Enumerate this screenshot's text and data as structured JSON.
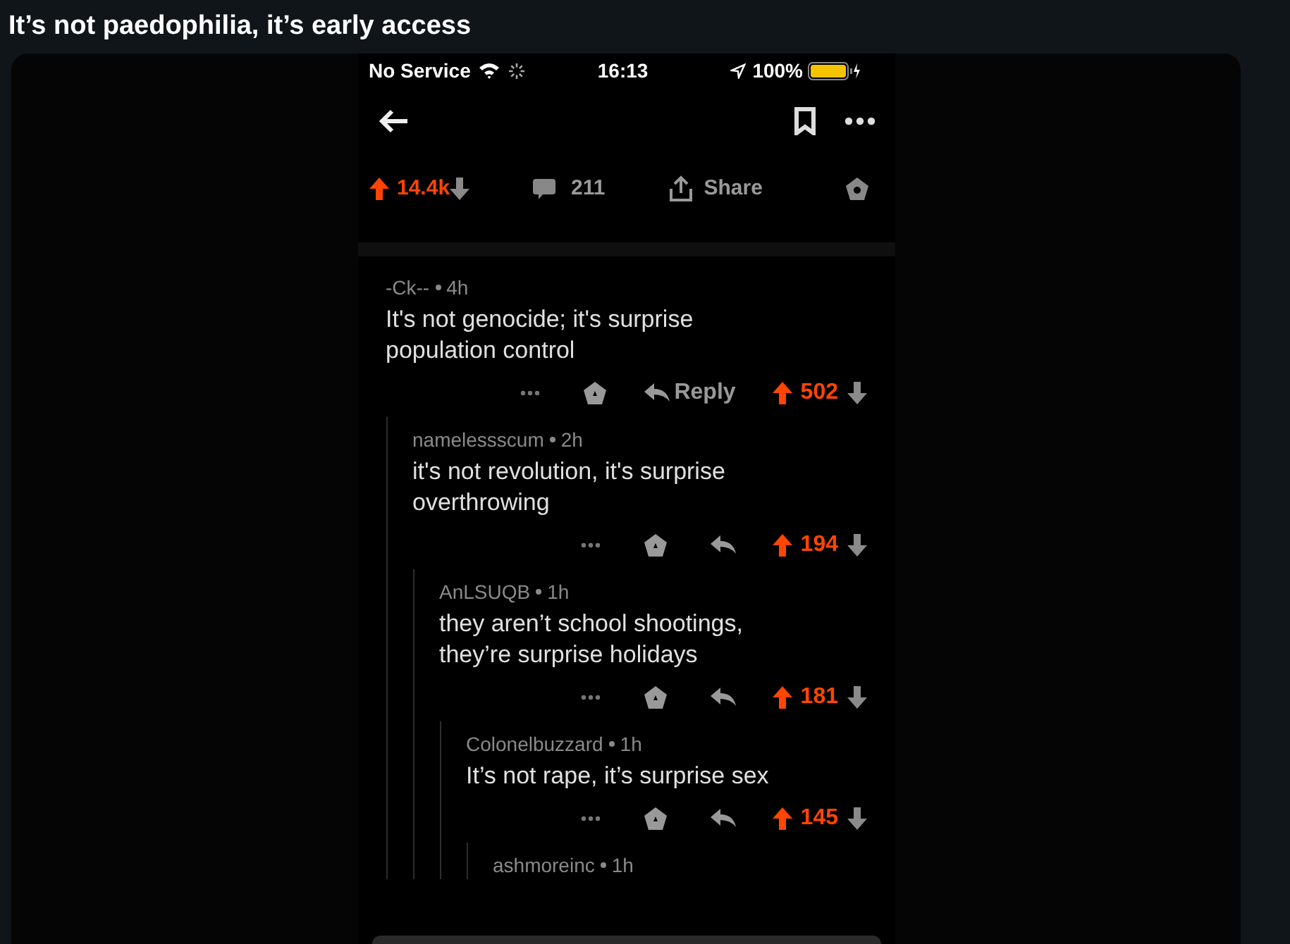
{
  "post_title": "It’s not paedophilia, it’s early access",
  "status_bar": {
    "carrier": "No Service",
    "time": "16:13",
    "battery": "100%"
  },
  "post_actions": {
    "score": "14.4k",
    "upvoted": true,
    "comments": "211",
    "share": "Share"
  },
  "comments": [
    {
      "author": "-Ck--",
      "age": "4h",
      "text": "It's not genocide; it's surprise population control",
      "reply_label": "Reply",
      "score": "502",
      "upvoted": true,
      "children": [
        {
          "author": "namelessscum",
          "age": "2h",
          "text": "it's not revolution, it's surprise overthrowing",
          "score": "194",
          "upvoted": true,
          "children": [
            {
              "author": "AnLSUQB",
              "age": "1h",
              "text": "they aren’t school shootings, they’re surprise holidays",
              "score": "181",
              "upvoted": true,
              "children": [
                {
                  "author": "Colonelbuzzard",
                  "age": "1h",
                  "text": "It’s not rape, it’s surprise sex",
                  "score": "145",
                  "upvoted": true,
                  "children": [
                    {
                      "author": "ashmoreinc",
                      "age": "1h"
                    }
                  ]
                }
              ]
            }
          ]
        }
      ]
    }
  ]
}
